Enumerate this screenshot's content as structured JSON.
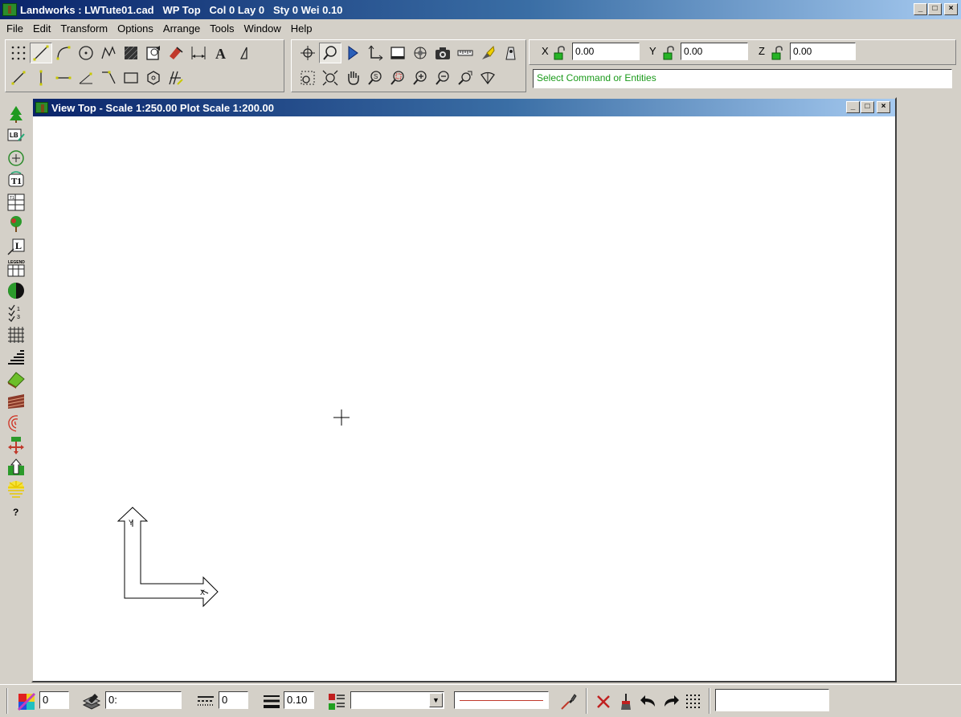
{
  "window": {
    "title": "Landworks : LWTute01.cad   WP Top   Col 0 Lay 0   Sty 0 Wei 0.10",
    "minimize": "_",
    "maximize": "□",
    "close": "×"
  },
  "menu": [
    "File",
    "Edit",
    "Transform",
    "Options",
    "Arrange",
    "Tools",
    "Window",
    "Help"
  ],
  "coords": {
    "x_label": "X",
    "x_value": "0.00",
    "y_label": "Y",
    "y_value": "0.00",
    "z_label": "Z",
    "z_value": "0.00"
  },
  "command_prompt": "Select Command or Entities",
  "view": {
    "title": "View Top - Scale 1:250.00 Plot Scale 1:200.00",
    "axis_y": "Y",
    "axis_x": "X"
  },
  "status": {
    "color_value": "0",
    "layer_value": "0:",
    "style_value": "0",
    "weight_value": "0.10",
    "dropdown_value": "",
    "empty_field": ""
  },
  "colors": {
    "title_gradient_start": "#0a246a",
    "title_gradient_end": "#a6caf0",
    "prompt_text": "#1a9a1a",
    "line_preview": "#c0392b"
  },
  "icons": {
    "left_toolbar": [
      "tree-icon",
      "label-icon",
      "target-icon",
      "text-t1-icon",
      "table-icon",
      "plant-icon",
      "level-l-icon",
      "legend-icon",
      "half-circle-icon",
      "fraction-icon",
      "grid-icon",
      "stairs-icon",
      "terrain-icon",
      "hatch-icon",
      "contour-icon",
      "move-icon",
      "elevate-icon",
      "sun-icon",
      "help-icon"
    ]
  }
}
